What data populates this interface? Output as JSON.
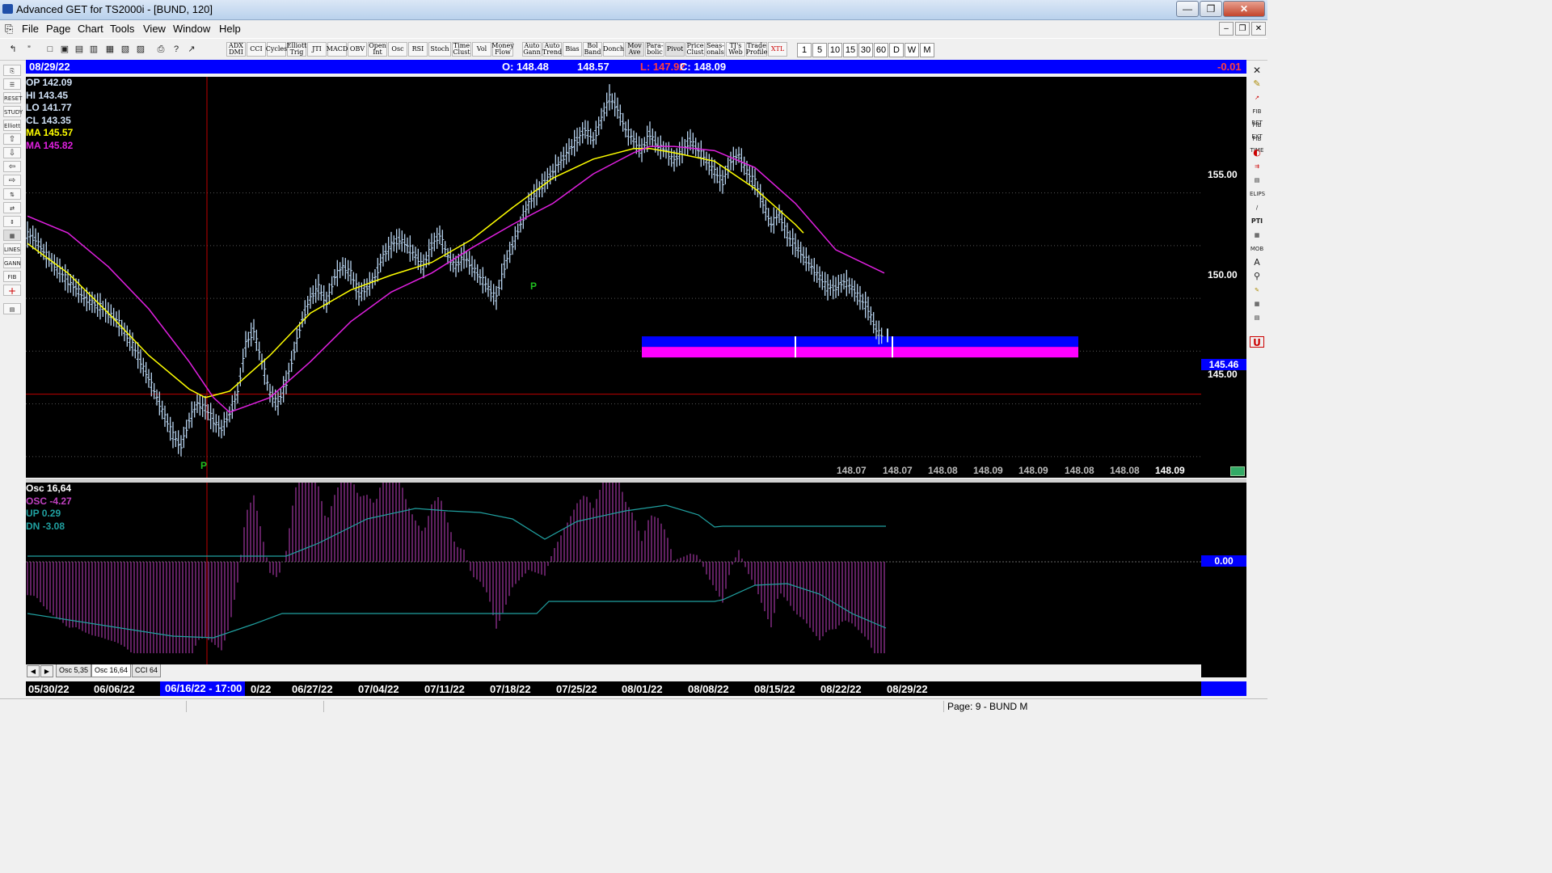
{
  "window": {
    "title": "Advanced GET for TS2000i - [BUND, 120]"
  },
  "menu": [
    "File",
    "Page",
    "Chart",
    "Tools",
    "View",
    "Window",
    "Help"
  ],
  "toolbar": {
    "indicators": [
      "ADX DMI",
      "CCI",
      "Cycles",
      "Elliott Trig",
      "JTI",
      "MACD",
      "OBV",
      "Open Int",
      "Osc",
      "RSI",
      "Stoch",
      "Time Clust",
      "Vol",
      "Money Flow",
      "Auto Gann",
      "Auto Trend",
      "Bias",
      "Bol Band",
      "Donch",
      "Mov Ave",
      "Para-bolic",
      "Pivot",
      "Price Clust",
      "Seas-onals",
      "TJ's Web",
      "Trade Profile",
      "XTL"
    ],
    "timeframes": [
      "1",
      "5",
      "10",
      "15",
      "30",
      "60",
      "D",
      "W",
      "M"
    ]
  },
  "left_tools": [
    "RESET",
    "STUDY",
    "Elliott",
    "LINES",
    "GANN",
    "FIB"
  ],
  "right_tools": [
    "FIB RET",
    "FIB EXT",
    "FIB TIME",
    "ELIPS",
    "PTI",
    "MOB",
    "A",
    "U"
  ],
  "header": {
    "date": "08/29/22",
    "open": "O: 148.48",
    "high": "148.57",
    "low": "L: 147.92",
    "close": "C: 148.09",
    "change": "-0.01"
  },
  "legend": {
    "op": "OP  142.09",
    "hi": "HI   143.45",
    "lo": "LO  141.77",
    "cl": "CL  143.35",
    "ma1": "MA  145.57",
    "ma2": "MA  145.82"
  },
  "price_axis": {
    "ticks": [
      "155.00",
      "150.00",
      "145.00"
    ],
    "crosshair": "145.46"
  },
  "recent_closes": [
    "148.07",
    "148.07",
    "148.08",
    "148.09",
    "148.09",
    "148.08",
    "148.08",
    "148.09"
  ],
  "pivots": [
    "P",
    "P"
  ],
  "osc_legend": {
    "title": "Osc 16,64",
    "osc": "OSC -4.27",
    "up": "UP   0.29",
    "dn": "DN   -3.08"
  },
  "osc_axis": {
    "zero": "0.00"
  },
  "tabs": [
    "Osc 5,35",
    "Osc 16,64",
    "CCI 64"
  ],
  "dates": [
    "05/30/22",
    "06/06/22",
    "06/16/22 - 17:00",
    "06/20/22",
    "06/27/22",
    "07/04/22",
    "07/11/22",
    "07/18/22",
    "07/25/22",
    "08/01/22",
    "08/08/22",
    "08/15/22",
    "08/22/22",
    "08/29/22"
  ],
  "dates_visible": [
    "05/30/22",
    "06/06/22",
    "06/16/22 - 17:00",
    "0/22",
    "06/27/22",
    "07/04/22",
    "07/11/22",
    "07/18/22",
    "07/25/22",
    "08/01/22",
    "08/08/22",
    "08/15/22",
    "08/22/22",
    "08/29/22"
  ],
  "status": {
    "page": "Page: 9 - BUND M"
  },
  "colors": {
    "background": "#000000",
    "bars": "#b8d4f0",
    "ma_fast": "#ffff00",
    "ma_slow": "#e020e0",
    "header": "#0000ff",
    "crosshair": "#c00000",
    "osc": "#c040c0",
    "osc_bands": "#20a0a0",
    "zone_blue": "#0000ff",
    "zone_magenta": "#ff00ff"
  },
  "chart_data": {
    "type": "line",
    "title": "",
    "ylim": [
      141.5,
      160.5
    ],
    "x_labels": [
      "05/30/22",
      "06/06/22",
      "06/20/22",
      "06/27/22",
      "07/04/22",
      "07/11/22",
      "07/18/22",
      "07/25/22",
      "08/01/22",
      "08/08/22",
      "08/15/22",
      "08/22/22",
      "08/29/22"
    ],
    "series": [
      {
        "name": "",
        "type": "price",
        "x": [
          0,
          10,
          20,
          30,
          40,
          50,
          60,
          70,
          80,
          90,
          100,
          110,
          120,
          130,
          140,
          150,
          160,
          170,
          180,
          190,
          200,
          210,
          220,
          230,
          240,
          250,
          260,
          270,
          280,
          290,
          300,
          310,
          320,
          330,
          340,
          350,
          360,
          370,
          380,
          390,
          400,
          410,
          420,
          430,
          440,
          450,
          460,
          470,
          480,
          490,
          500,
          510,
          520,
          530,
          540,
          550,
          560,
          570,
          580,
          590,
          600,
          610,
          620,
          630,
          640,
          650,
          660,
          670,
          680,
          690,
          700,
          710,
          720,
          730,
          740,
          750,
          760,
          770,
          780,
          790,
          800,
          810,
          820,
          830,
          840,
          850,
          860,
          870,
          880,
          890,
          900,
          910,
          920,
          930,
          940,
          950,
          960,
          970,
          980,
          990,
          1000,
          1010,
          1020,
          1030,
          1040,
          1050,
          1060
        ],
        "y": [
          153.0,
          152.8,
          152.2,
          151.7,
          151.3,
          150.8,
          150.5,
          150.0,
          149.8,
          149.6,
          149.3,
          149.0,
          148.4,
          147.8,
          147.0,
          146.2,
          145.3,
          144.4,
          143.5,
          143.0,
          144.2,
          145.0,
          144.8,
          144.2,
          143.8,
          144.5,
          145.5,
          147.8,
          148.5,
          147.0,
          145.5,
          145.0,
          146.0,
          147.5,
          149.0,
          150.0,
          150.5,
          149.8,
          151.0,
          151.5,
          151.2,
          150.2,
          150.5,
          151.0,
          152.0,
          152.5,
          152.8,
          152.5,
          152.0,
          151.5,
          152.5,
          153.0,
          152.0,
          151.5,
          152.0,
          151.5,
          151.0,
          150.5,
          150.0,
          151.5,
          152.5,
          153.5,
          154.5,
          155.0,
          155.5,
          156.0,
          156.5,
          157.0,
          157.5,
          158.0,
          157.5,
          158.5,
          159.5,
          159.0,
          158.0,
          157.5,
          157.0,
          157.8,
          157.2,
          157.0,
          156.5,
          157.0,
          157.5,
          157.0,
          156.5,
          156.0,
          155.5,
          156.5,
          156.8,
          156.0,
          155.5,
          154.5,
          153.5,
          154.0,
          153.0,
          152.5,
          152.0,
          151.5,
          151.0,
          150.5,
          150.5,
          150.8,
          150.5,
          150.0,
          149.5,
          148.5,
          148.09
        ]
      },
      {
        "name": "MA 145.57",
        "type": "ma_fast",
        "x": [
          0,
          50,
          100,
          150,
          200,
          220,
          250,
          300,
          350,
          400,
          450,
          500,
          550,
          600,
          650,
          700,
          750,
          770,
          800,
          850,
          900,
          950,
          960
        ],
        "y": [
          152.6,
          151.2,
          149.3,
          147.3,
          145.7,
          145.3,
          145.6,
          147.3,
          149.3,
          150.4,
          151.1,
          151.7,
          152.8,
          154.3,
          155.7,
          156.6,
          157.1,
          157.1,
          156.9,
          156.5,
          155.2,
          153.5,
          153.1
        ]
      },
      {
        "name": "MA 145.82",
        "type": "ma_slow",
        "x": [
          0,
          50,
          100,
          150,
          200,
          230,
          250,
          300,
          350,
          400,
          450,
          500,
          550,
          600,
          650,
          700,
          750,
          770,
          800,
          850,
          900,
          950,
          1000,
          1060
        ],
        "y": [
          153.9,
          153.1,
          151.5,
          149.5,
          147.0,
          145.3,
          144.6,
          145.3,
          147.0,
          148.9,
          150.3,
          151.2,
          152.4,
          153.5,
          154.5,
          155.9,
          156.9,
          157.2,
          157.2,
          157.0,
          156.2,
          154.5,
          152.3,
          151.2
        ]
      }
    ],
    "zones": [
      {
        "from": 148.2,
        "to": 147.2,
        "x_start": 760,
        "x_end": 1300
      }
    ]
  }
}
